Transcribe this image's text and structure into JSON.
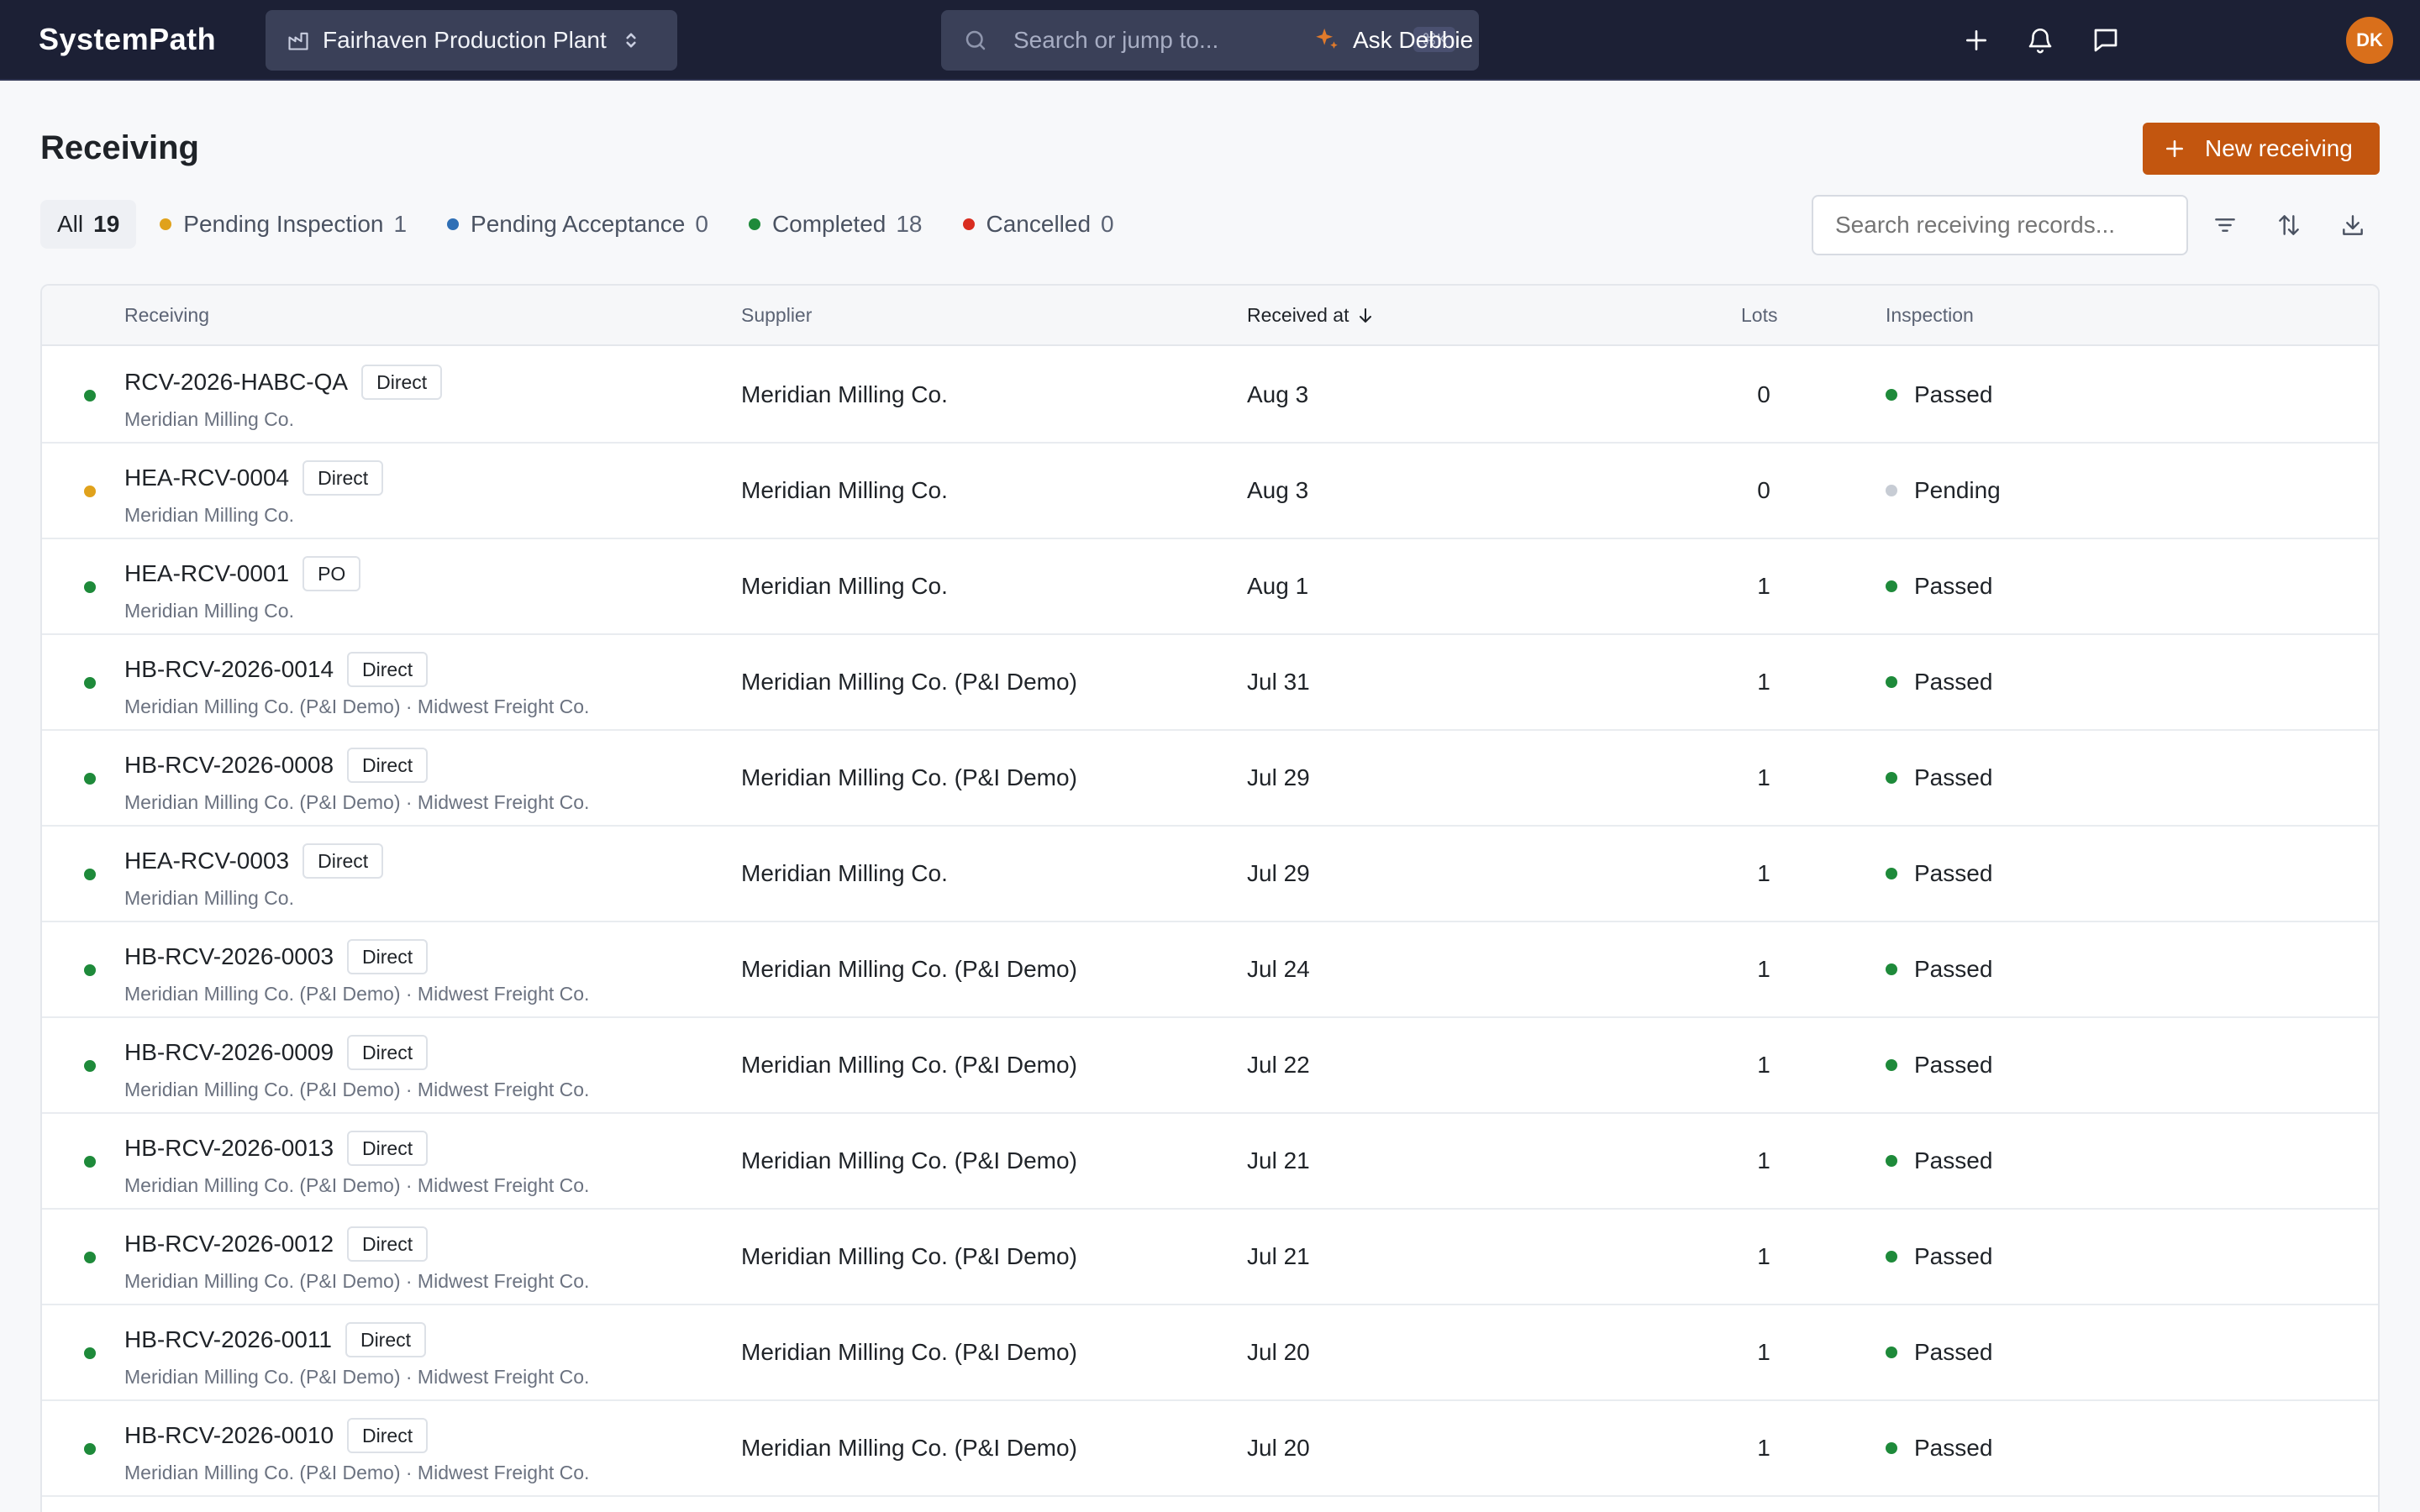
{
  "app": {
    "logo": "SystemPath",
    "plant_name": "Fairhaven Production Plant",
    "search_placeholder": "Search or jump to...",
    "search_shortcut": "⌘K",
    "assistant_label": "Ask Debbie",
    "user_initials": "DK"
  },
  "page": {
    "title": "Receiving",
    "new_button_label": "New receiving",
    "search_placeholder": "Search receiving records..."
  },
  "colors": {
    "brand_dark": "#1c2035",
    "accent": "#c3560f",
    "status_completed": "#1e8a3a",
    "status_pending_inspection": "#e0a21c",
    "status_pending_acceptance": "#2f6fb5",
    "status_cancelled": "#d92d20",
    "inspection_pending": "#c7ccd4"
  },
  "tabs": [
    {
      "label": "All",
      "count": "19",
      "dot": "",
      "active": true
    },
    {
      "label": "Pending Inspection",
      "count": "1",
      "dot": "#e0a21c",
      "active": false
    },
    {
      "label": "Pending Acceptance",
      "count": "0",
      "dot": "#2f6fb5",
      "active": false
    },
    {
      "label": "Completed",
      "count": "18",
      "dot": "#1e8a3a",
      "active": false
    },
    {
      "label": "Cancelled",
      "count": "0",
      "dot": "#d92d20",
      "active": false
    }
  ],
  "table": {
    "columns": {
      "receiving": "Receiving",
      "supplier": "Supplier",
      "received_at": "Received at",
      "lots": "Lots",
      "inspection": "Inspection"
    },
    "rows": [
      {
        "id": "RCV-2026-HABC-QA",
        "type": "Direct",
        "sub": "Meridian Milling Co.",
        "supplier": "Meridian Milling Co.",
        "date": "Aug 3",
        "lots": "0",
        "inspection": "Passed",
        "status_color": "#1e8a3a",
        "inspection_color": "#1e8a3a",
        "menu": false
      },
      {
        "id": "HEA-RCV-0004",
        "type": "Direct",
        "sub": "Meridian Milling Co.",
        "supplier": "Meridian Milling Co.",
        "date": "Aug 3",
        "lots": "0",
        "inspection": "Pending",
        "status_color": "#e0a21c",
        "inspection_color": "#c7ccd4",
        "menu": true
      },
      {
        "id": "HEA-RCV-0001",
        "type": "PO",
        "sub": "Meridian Milling Co.",
        "supplier": "Meridian Milling Co.",
        "date": "Aug 1",
        "lots": "1",
        "inspection": "Passed",
        "status_color": "#1e8a3a",
        "inspection_color": "#1e8a3a",
        "menu": false
      },
      {
        "id": "HB-RCV-2026-0014",
        "type": "Direct",
        "sub": "Meridian Milling Co. (P&I Demo) · Midwest Freight Co.",
        "supplier": "Meridian Milling Co. (P&I Demo)",
        "date": "Jul 31",
        "lots": "1",
        "inspection": "Passed",
        "status_color": "#1e8a3a",
        "inspection_color": "#1e8a3a",
        "menu": false
      },
      {
        "id": "HB-RCV-2026-0008",
        "type": "Direct",
        "sub": "Meridian Milling Co. (P&I Demo) · Midwest Freight Co.",
        "supplier": "Meridian Milling Co. (P&I Demo)",
        "date": "Jul 29",
        "lots": "1",
        "inspection": "Passed",
        "status_color": "#1e8a3a",
        "inspection_color": "#1e8a3a",
        "menu": false
      },
      {
        "id": "HEA-RCV-0003",
        "type": "Direct",
        "sub": "Meridian Milling Co.",
        "supplier": "Meridian Milling Co.",
        "date": "Jul 29",
        "lots": "1",
        "inspection": "Passed",
        "status_color": "#1e8a3a",
        "inspection_color": "#1e8a3a",
        "menu": false
      },
      {
        "id": "HB-RCV-2026-0003",
        "type": "Direct",
        "sub": "Meridian Milling Co. (P&I Demo) · Midwest Freight Co.",
        "supplier": "Meridian Milling Co. (P&I Demo)",
        "date": "Jul 24",
        "lots": "1",
        "inspection": "Passed",
        "status_color": "#1e8a3a",
        "inspection_color": "#1e8a3a",
        "menu": false
      },
      {
        "id": "HB-RCV-2026-0009",
        "type": "Direct",
        "sub": "Meridian Milling Co. (P&I Demo) · Midwest Freight Co.",
        "supplier": "Meridian Milling Co. (P&I Demo)",
        "date": "Jul 22",
        "lots": "1",
        "inspection": "Passed",
        "status_color": "#1e8a3a",
        "inspection_color": "#1e8a3a",
        "menu": false
      },
      {
        "id": "HB-RCV-2026-0013",
        "type": "Direct",
        "sub": "Meridian Milling Co. (P&I Demo) · Midwest Freight Co.",
        "supplier": "Meridian Milling Co. (P&I Demo)",
        "date": "Jul 21",
        "lots": "1",
        "inspection": "Passed",
        "status_color": "#1e8a3a",
        "inspection_color": "#1e8a3a",
        "menu": false
      },
      {
        "id": "HB-RCV-2026-0012",
        "type": "Direct",
        "sub": "Meridian Milling Co. (P&I Demo) · Midwest Freight Co.",
        "supplier": "Meridian Milling Co. (P&I Demo)",
        "date": "Jul 21",
        "lots": "1",
        "inspection": "Passed",
        "status_color": "#1e8a3a",
        "inspection_color": "#1e8a3a",
        "menu": false
      },
      {
        "id": "HB-RCV-2026-0011",
        "type": "Direct",
        "sub": "Meridian Milling Co. (P&I Demo) · Midwest Freight Co.",
        "supplier": "Meridian Milling Co. (P&I Demo)",
        "date": "Jul 20",
        "lots": "1",
        "inspection": "Passed",
        "status_color": "#1e8a3a",
        "inspection_color": "#1e8a3a",
        "menu": false
      },
      {
        "id": "HB-RCV-2026-0010",
        "type": "Direct",
        "sub": "Meridian Milling Co. (P&I Demo) · Midwest Freight Co.",
        "supplier": "Meridian Milling Co. (P&I Demo)",
        "date": "Jul 20",
        "lots": "1",
        "inspection": "Passed",
        "status_color": "#1e8a3a",
        "inspection_color": "#1e8a3a",
        "menu": false
      }
    ]
  },
  "icons": {
    "plant": "factory-icon",
    "plant_switch": "chevron-up-down-icon",
    "search": "search-icon",
    "add": "plus-icon",
    "notifications": "bell-icon",
    "messages": "chat-icon",
    "assistant": "sparkle-icon",
    "filter": "filter-icon",
    "sort": "sort-icon",
    "download": "download-icon",
    "row_menu": "more-vertical-icon"
  }
}
